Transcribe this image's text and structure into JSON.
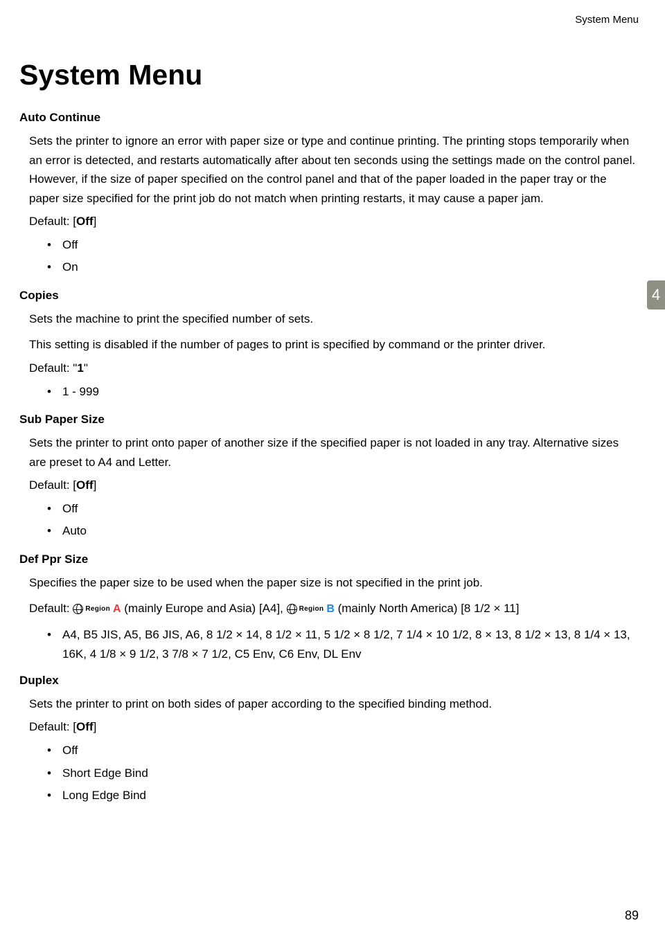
{
  "header": {
    "running_head": "System Menu"
  },
  "title": "System Menu",
  "chapter_tab": "4",
  "page_number": "89",
  "sections": {
    "auto_continue": {
      "heading": "Auto Continue",
      "body": "Sets the printer to ignore an error with paper size or type and continue printing. The printing stops temporarily when an error is detected, and restarts automatically after about ten seconds using the settings made on the control panel. However, if the size of paper specified on the control panel and that of the paper loaded in the paper tray or the paper size specified for the print job do not match when printing restarts, it may cause a paper jam.",
      "default_prefix": "Default: [",
      "default_value": "Off",
      "default_suffix": "]",
      "options": [
        "Off",
        "On"
      ]
    },
    "copies": {
      "heading": "Copies",
      "b1": "Sets the machine to print the specified number of sets.",
      "b2": "This setting is disabled if the number of pages to print is specified by command or the printer driver.",
      "default_prefix": "Default: \"",
      "default_value": "1",
      "default_suffix": "\"",
      "options": [
        "1 - 999"
      ]
    },
    "sub_paper": {
      "heading": "Sub Paper Size",
      "body": "Sets the printer to print onto paper of another size if the specified paper is not loaded in any tray. Alternative sizes are preset to A4 and Letter.",
      "default_prefix": "Default: [",
      "default_value": "Off",
      "default_suffix": "]",
      "options": [
        "Off",
        "Auto"
      ]
    },
    "def_ppr": {
      "heading": "Def Ppr Size",
      "body": "Specifies the paper size to be used when the paper size is not specified in the print job.",
      "default_prefix": "Default: ",
      "region_a_text": " (mainly Europe and Asia) [A4], ",
      "region_b_text": " (mainly North America) [8 1/2 × 11]",
      "region_label": "Region",
      "sizes": "A4, B5 JIS, A5, B6 JIS, A6, 8 1/2 × 14, 8 1/2 × 11, 5 1/2 × 8 1/2, 7 1/4 × 10 1/2, 8 × 13, 8 1/2 × 13, 8 1/4 × 13, 16K, 4 1/8 × 9 1/2, 3 7/8 × 7 1/2, C5 Env, C6 Env, DL Env"
    },
    "duplex": {
      "heading": "Duplex",
      "body": "Sets the printer to print on both sides of paper according to the specified binding method.",
      "default_prefix": "Default: [",
      "default_value": "Off",
      "default_suffix": "]",
      "options": [
        "Off",
        "Short Edge Bind",
        "Long Edge Bind"
      ]
    }
  }
}
